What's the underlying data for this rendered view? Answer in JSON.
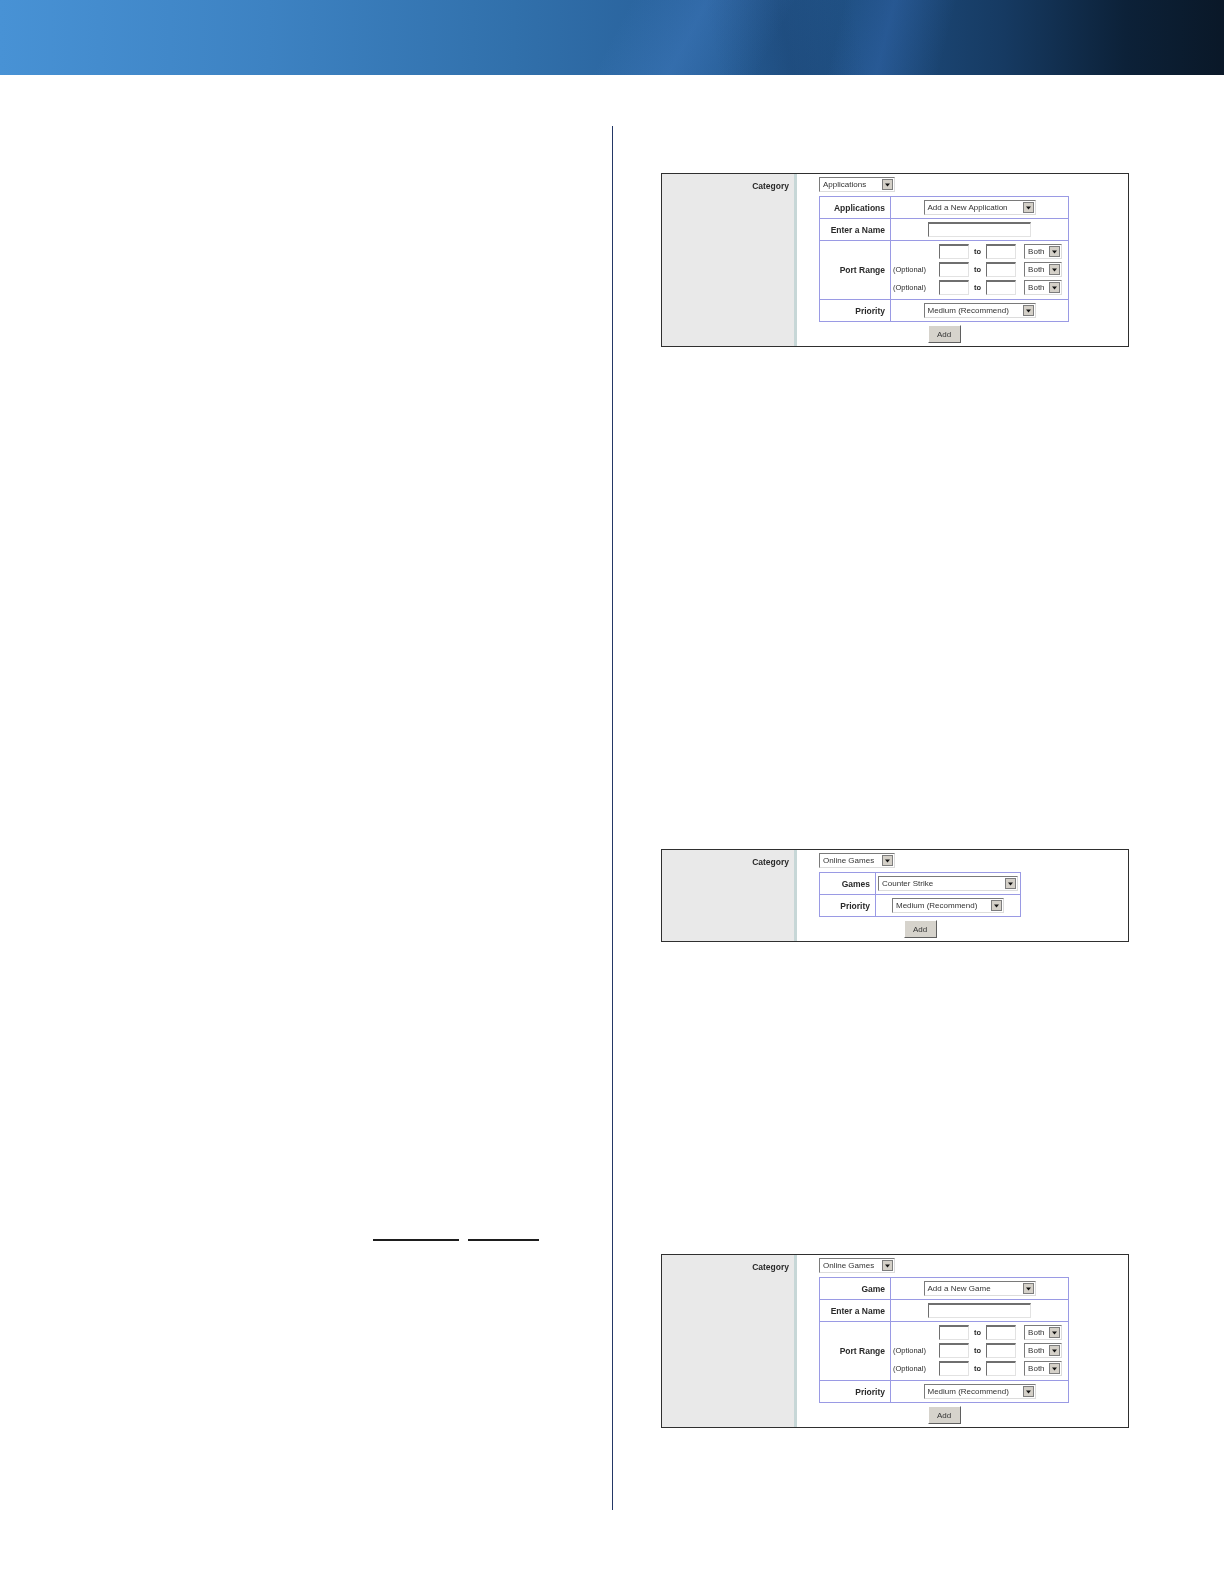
{
  "figures": [
    {
      "category": {
        "label": "Category",
        "value": "Applications"
      },
      "rows": [
        {
          "kind": "select",
          "label": "Applications",
          "value": "Add a New Application"
        },
        {
          "kind": "text",
          "label": "Enter a Name"
        },
        {
          "kind": "port_range",
          "label": "Port Range",
          "ranges": [
            {
              "separator": "to",
              "protocol": "Both"
            },
            {
              "note": "(Optional)",
              "separator": "to",
              "protocol": "Both"
            },
            {
              "note": "(Optional)",
              "separator": "to",
              "protocol": "Both"
            }
          ]
        },
        {
          "kind": "select",
          "label": "Priority",
          "value": "Medium (Recommend)"
        }
      ],
      "button": "Add"
    },
    {
      "category": {
        "label": "Category",
        "value": "Online Games"
      },
      "rows": [
        {
          "kind": "select",
          "label": "Games",
          "value": "Counter Strike"
        },
        {
          "kind": "select",
          "label": "Priority",
          "value": "Medium (Recommend)"
        }
      ],
      "button": "Add"
    },
    {
      "category": {
        "label": "Category",
        "value": "Online Games"
      },
      "rows": [
        {
          "kind": "select",
          "label": "Game",
          "value": "Add a New Game"
        },
        {
          "kind": "text",
          "label": "Enter a Name"
        },
        {
          "kind": "port_range",
          "label": "Port Range",
          "ranges": [
            {
              "separator": "to",
              "protocol": "Both"
            },
            {
              "note": "(Optional)",
              "separator": "to",
              "protocol": "Both"
            },
            {
              "note": "(Optional)",
              "separator": "to",
              "protocol": "Both"
            }
          ]
        },
        {
          "kind": "select",
          "label": "Priority",
          "value": "Medium (Recommend)"
        }
      ],
      "button": "Add"
    }
  ]
}
